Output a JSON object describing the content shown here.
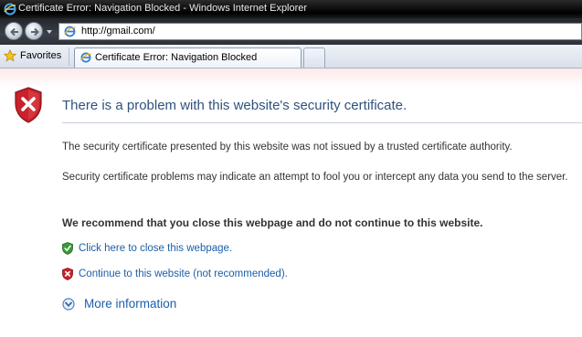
{
  "window": {
    "title": "Certificate Error: Navigation Blocked - Windows Internet Explorer",
    "icon": "ie-icon"
  },
  "navigation": {
    "back_icon": "back-arrow-icon",
    "forward_icon": "forward-arrow-icon",
    "address": "http://gmail.com/"
  },
  "favorites_bar": {
    "favorites_label": "Favorites",
    "tab_label": "Certificate Error: Navigation Blocked"
  },
  "content": {
    "heading": "There is a problem with this website's security certificate.",
    "paragraph_1": "The security certificate presented by this website was not issued by a trusted certificate authority.",
    "paragraph_2": "Security certificate problems may indicate an attempt to fool you or intercept any data you send to the server.",
    "recommendation": "We recommend that you close this webpage and do not continue to this website.",
    "close_link": "Click here to close this webpage.",
    "continue_link": "Continue to this website (not recommended).",
    "more_info": "More information"
  },
  "colors": {
    "heading": "#31527e",
    "link": "#1c5fa8",
    "shield_red": "#c8222b",
    "safe_green": "#3a9a3a"
  }
}
